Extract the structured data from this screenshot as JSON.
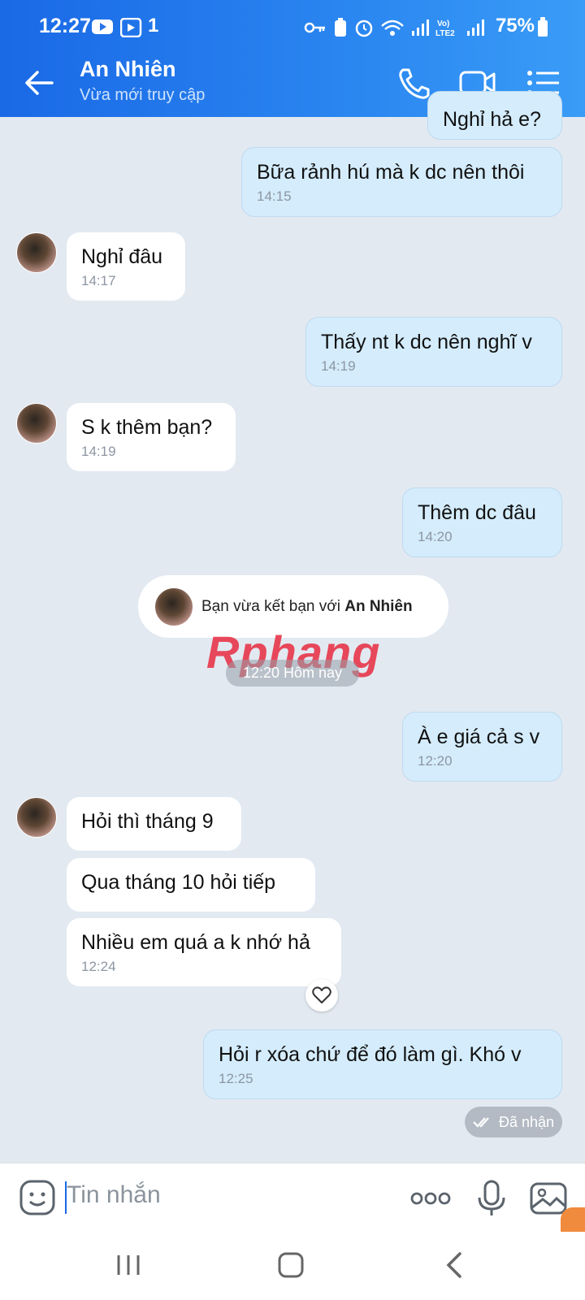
{
  "status_bar": {
    "time": "12:27",
    "notif_extra": "1",
    "battery": "75%"
  },
  "header": {
    "contact_name": "An Nhiên",
    "status": "Vừa mới truy cập"
  },
  "messages": [
    {
      "text": "Nghỉ hả e?",
      "time": ""
    },
    {
      "text": "Bữa rảnh hú mà k dc nên thôi",
      "time": "14:15"
    },
    {
      "text": "Nghỉ đâu",
      "time": "14:17"
    },
    {
      "text": "Thấy nt k dc nên nghĩ v",
      "time": "14:19"
    },
    {
      "text": "S k thêm bạn?",
      "time": "14:19"
    },
    {
      "text": "Thêm dc đâu",
      "time": "14:20"
    },
    {
      "text": "À e giá cả s v",
      "time": "12:20"
    },
    {
      "text": "Hỏi thì tháng 9",
      "time": ""
    },
    {
      "text": "Qua tháng 10 hỏi tiếp",
      "time": ""
    },
    {
      "text": "Nhiều em quá a k nhớ hả",
      "time": "12:24"
    },
    {
      "text": "Hỏi r xóa chứ để đó làm gì. Khó v",
      "time": "12:25"
    }
  ],
  "system_notice": {
    "prefix": "Bạn vừa kết bạn với ",
    "name": "An Nhiên"
  },
  "time_divider": "12:20 Hôm nay",
  "watermark": {
    "part1": "Rphang",
    "part2": ""
  },
  "delivery_status": "Đã nhận",
  "composer": {
    "placeholder": "Tin nhắn"
  },
  "colors": {
    "header": "#1a69e6",
    "my_bubble": "#d4ecfc",
    "their_bubble": "#ffffff",
    "background": "#e2e9f1"
  }
}
